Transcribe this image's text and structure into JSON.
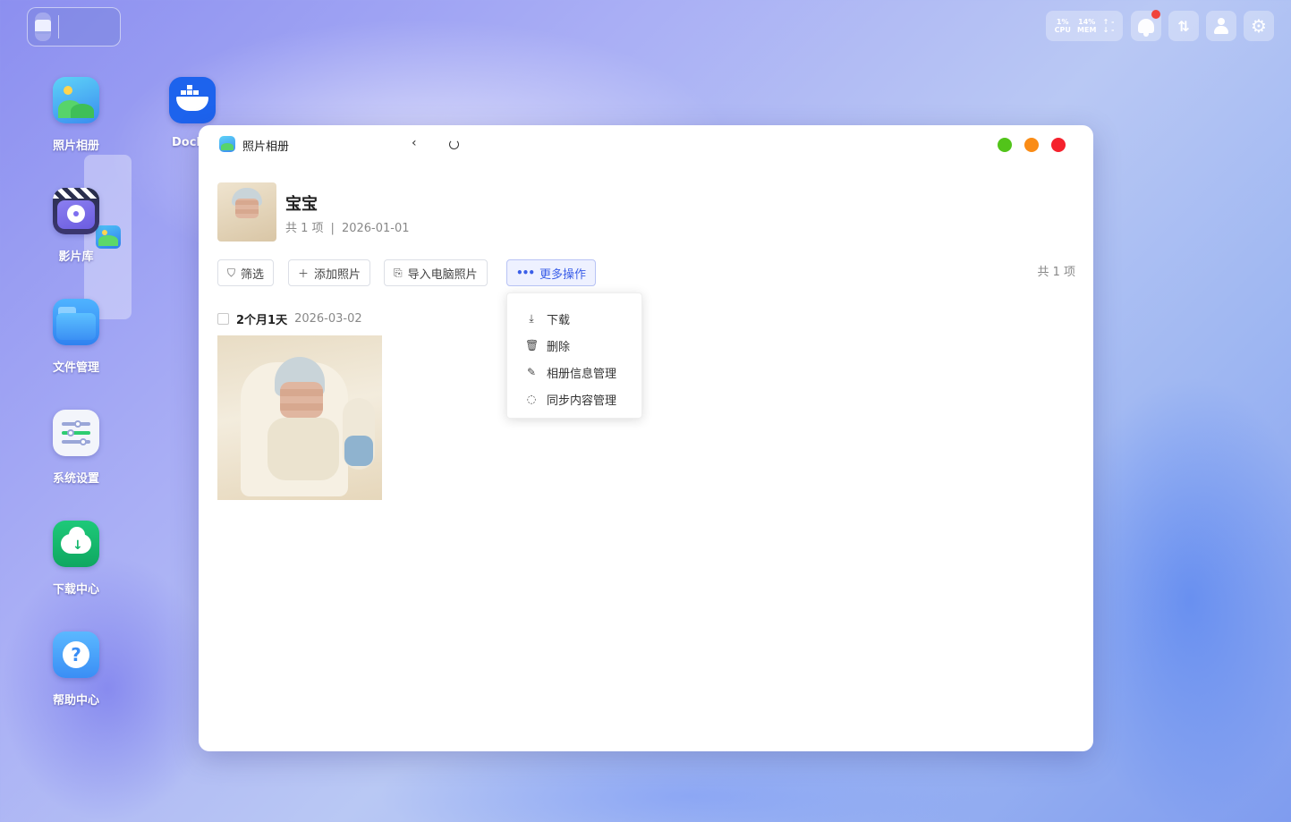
{
  "desktop": {
    "apps": [
      {
        "label": "照片相册",
        "icon": "photos-app-icon"
      },
      {
        "label": "影片库",
        "icon": "video-library-icon"
      },
      {
        "label": "文件管理",
        "icon": "folder-icon"
      },
      {
        "label": "系统设置",
        "icon": "settings-sliders-icon"
      },
      {
        "label": "下载中心",
        "icon": "cloud-download-icon"
      },
      {
        "label": "帮助中心",
        "icon": "help-question-icon"
      },
      {
        "label": "Docl",
        "icon": "docker-whale-icon"
      }
    ]
  },
  "tray": {
    "cpu_value": "1%",
    "cpu_label": "CPU",
    "mem_value": "14%",
    "mem_label": "MEM",
    "net_up": "↑ -",
    "net_down": "↓ -",
    "notification_dot_color": "#f0443c"
  },
  "window": {
    "title": "照片相册",
    "back_glyph": "‹",
    "traffic_lights": {
      "green": "#52c41a",
      "orange": "#fa8c16",
      "red": "#f5222d"
    }
  },
  "album": {
    "name": "宝宝",
    "count_text": "共 1 项",
    "separator": "|",
    "date": "2026-01-01"
  },
  "toolbar": {
    "filter_label": "筛选",
    "add_photo_label": "添加照片",
    "import_label": "导入电脑照片",
    "more_label": "更多操作",
    "total_text": "共 1 项"
  },
  "group": {
    "title": "2个月1天",
    "date": "2026-03-02"
  },
  "dropdown": {
    "items": [
      {
        "label": "下载",
        "icon": "download-icon"
      },
      {
        "label": "删除",
        "icon": "trash-icon"
      },
      {
        "label": "相册信息管理",
        "icon": "edit-icon"
      },
      {
        "label": "同步内容管理",
        "icon": "sync-icon"
      }
    ]
  },
  "colors": {
    "accent": "#3a5ee8",
    "accent_bg": "#eef1ff"
  }
}
